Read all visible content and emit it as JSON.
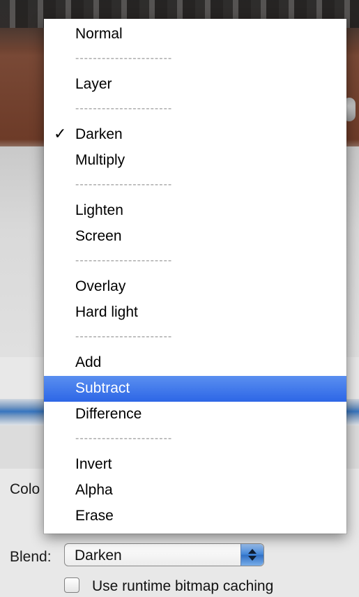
{
  "form": {
    "color_label": "Colo",
    "blend_label": "Blend:",
    "blend_value": "Darken",
    "cache_label": "Use runtime bitmap caching",
    "cache_checked": false
  },
  "menu": {
    "selected": "Darken",
    "highlighted": "Subtract",
    "separator_text": "----------------------",
    "items": [
      {
        "label": "Normal"
      },
      {
        "separator": true
      },
      {
        "label": "Layer"
      },
      {
        "separator": true
      },
      {
        "label": "Darken",
        "checked": true
      },
      {
        "label": "Multiply"
      },
      {
        "separator": true
      },
      {
        "label": "Lighten"
      },
      {
        "label": "Screen"
      },
      {
        "separator": true
      },
      {
        "label": "Overlay"
      },
      {
        "label": "Hard light"
      },
      {
        "separator": true
      },
      {
        "label": "Add"
      },
      {
        "label": "Subtract",
        "highlighted": true
      },
      {
        "label": "Difference"
      },
      {
        "separator": true
      },
      {
        "label": "Invert"
      },
      {
        "label": "Alpha"
      },
      {
        "label": "Erase"
      }
    ]
  },
  "icons": {
    "check": "✓",
    "stepper": "up-down-arrows-icon"
  },
  "colors": {
    "highlight": "#2d66e6",
    "stepper": "#3f83d6"
  }
}
